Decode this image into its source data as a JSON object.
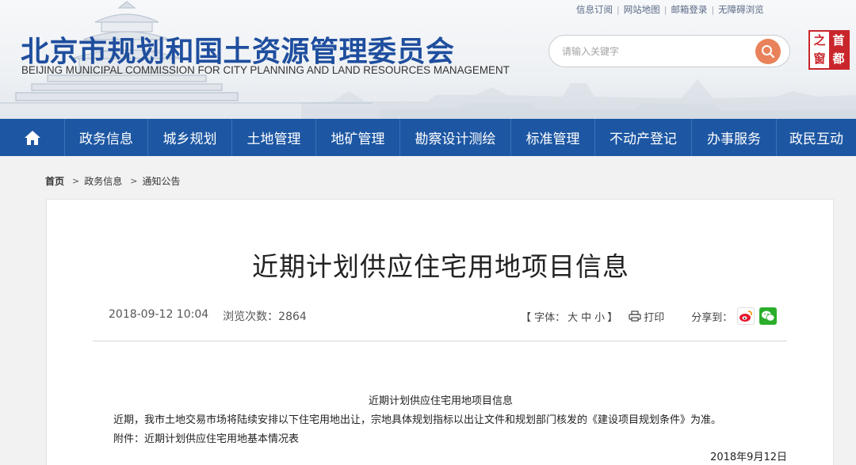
{
  "top_links": [
    "信息订阅",
    "网站地图",
    "邮箱登录",
    "无障碍浏览"
  ],
  "site": {
    "title": "北京市规划和国土资源管理委员会",
    "subtitle": "BEIJING MUNICIPAL COMMISSION FOR CITY PLANNING AND LAND RESOURCES MANAGEMENT"
  },
  "search": {
    "placeholder": "请输入关键字"
  },
  "badge": [
    "首",
    "都",
    "之",
    "窗"
  ],
  "nav": [
    "政务信息",
    "城乡规划",
    "土地管理",
    "地矿管理",
    "勘察设计测绘",
    "标准管理",
    "不动产登记",
    "办事服务",
    "政民互动"
  ],
  "breadcrumb": [
    "首页",
    "政务信息",
    "通知公告"
  ],
  "article": {
    "title": "近期计划供应住宅用地项目信息",
    "datetime": "2018-09-12 10:04",
    "views": "浏览次数：2864",
    "font_label_open": "【 字体：",
    "font_sizes": [
      "大",
      "中",
      "小"
    ],
    "font_label_close": "】",
    "print_label": "打印",
    "share_label": "分享到：",
    "content_title": "近期计划供应住宅用地项目信息",
    "paragraph1": "近期，我市土地交易市场将陆续安排以下住宅用地出让，宗地具体规划指标以出让文件和规划部门核发的《建设项目规划条件》为准。",
    "paragraph2": "附件：近期计划供应住宅用地基本情况表",
    "date_signed": "2018年9月12日"
  },
  "colors": {
    "nav_bg": "#1d57a3",
    "title_blue": "#1f4e9e",
    "search_btn": "#e9825a",
    "badge_red": "#c9262b"
  }
}
